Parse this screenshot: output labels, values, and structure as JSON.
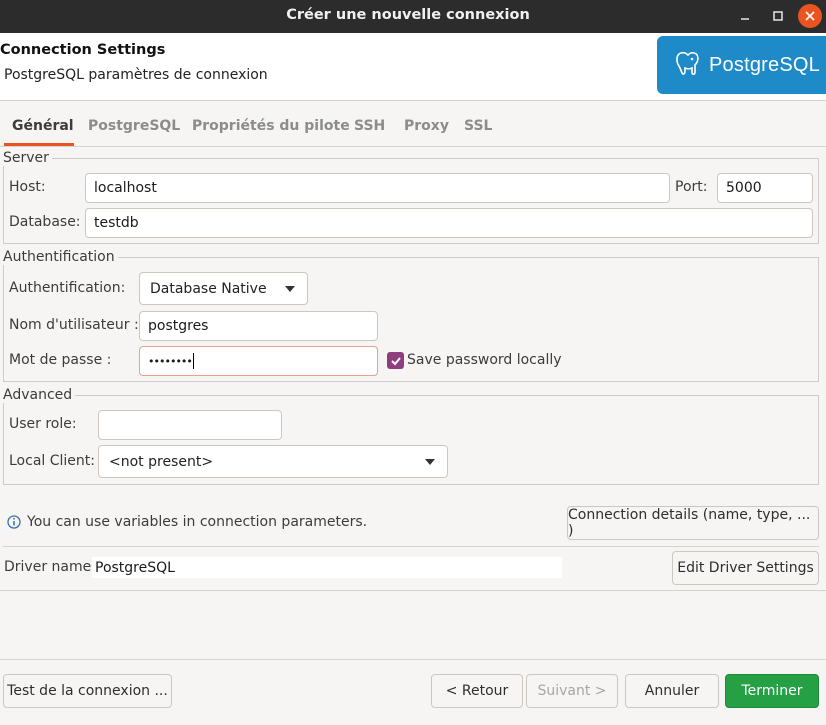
{
  "window": {
    "title": "Créer une nouvelle connexion"
  },
  "header": {
    "title": "Connection Settings",
    "subtitle": "PostgreSQL paramètres de connexion",
    "logo_text": "PostgreSQL"
  },
  "tabs": [
    {
      "label": "Général",
      "active": true
    },
    {
      "label": "PostgreSQL",
      "active": false
    },
    {
      "label": "Propriétés du pilote",
      "active": false
    },
    {
      "label": "SSH",
      "active": false
    },
    {
      "label": "Proxy",
      "active": false
    },
    {
      "label": "SSL",
      "active": false
    }
  ],
  "server": {
    "group_label": "Server",
    "host_label": "Host:",
    "host_value": "localhost",
    "port_label": "Port:",
    "port_value": "5000",
    "database_label": "Database:",
    "database_value": "testdb"
  },
  "auth": {
    "group_label": "Authentification",
    "method_label": "Authentification:",
    "method_value": "Database Native",
    "user_label": "Nom d'utilisateur :",
    "user_value": "postgres",
    "password_label": "Mot de passe :",
    "password_value": "••••••••",
    "save_password_label": "Save password locally",
    "save_password_checked": true
  },
  "advanced": {
    "group_label": "Advanced",
    "user_role_label": "User role:",
    "user_role_value": "",
    "local_client_label": "Local Client:",
    "local_client_value": "<not present>"
  },
  "info": {
    "text": "You can use variables in connection parameters.",
    "details_button": "Connection details (name, type, ... )"
  },
  "driver": {
    "label": "Driver name:",
    "value": "PostgreSQL",
    "edit_button": "Edit Driver Settings"
  },
  "footer": {
    "test_button": "Test de la connexion ...",
    "back_button": "< Retour",
    "next_button": "Suivant >",
    "cancel_button": "Annuler",
    "finish_button": "Terminer"
  },
  "colors": {
    "accent": "#e95420",
    "logo_bg": "#1e8bc8",
    "checkbox": "#8e3d7e",
    "finish": "#26a044"
  },
  "icons": [
    "minimize-icon",
    "maximize-icon",
    "close-icon",
    "postgresql-elephant-icon",
    "dropdown-arrow-icon",
    "checkmark-icon",
    "info-icon"
  ]
}
